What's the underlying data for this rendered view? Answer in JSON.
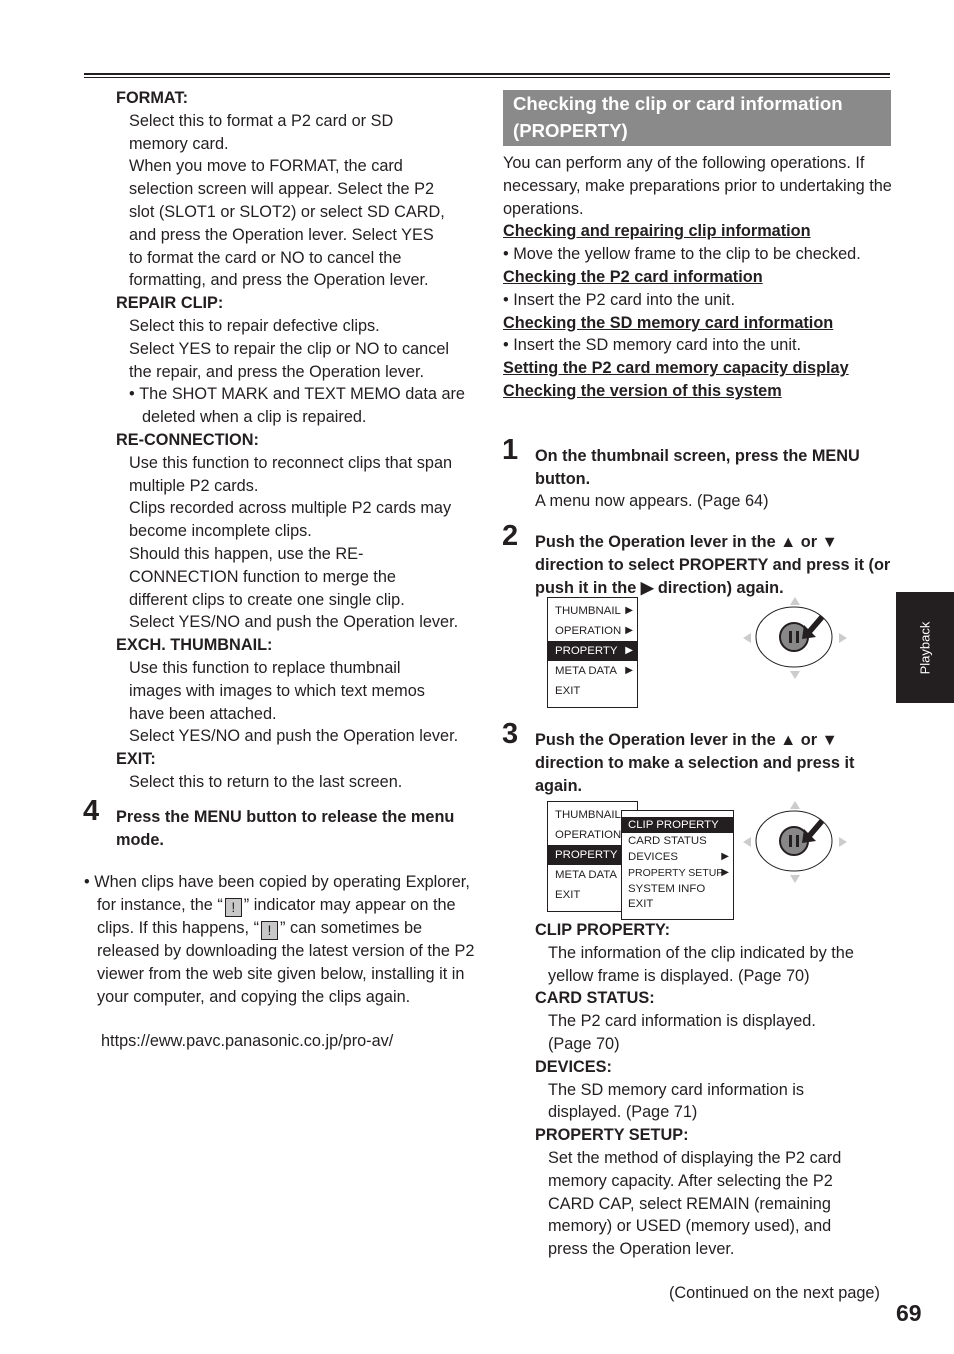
{
  "left": {
    "items": [
      {
        "term": "FORMAT:",
        "lines": [
          "Select this to format a P2 card or SD",
          "memory card.",
          "When you move to FORMAT, the card",
          "selection screen will appear. Select the P2",
          "slot (SLOT1 or SLOT2) or select SD CARD,",
          "and press the Operation lever. Select YES",
          "to format the card or NO to cancel the",
          "formatting, and press the Operation lever."
        ]
      },
      {
        "term": "REPAIR CLIP:",
        "lines": [
          "Select this to repair defective clips.",
          "Select YES to repair the clip or NO to cancel",
          "the repair, and press the Operation lever."
        ],
        "bullet": "The SHOT MARK and TEXT MEMO data are deleted when a clip is repaired."
      },
      {
        "term": "RE-CONNECTION:",
        "lines": [
          "Use this function to reconnect clips that span",
          "multiple P2 cards.",
          "Clips recorded across multiple P2 cards may",
          "become incomplete clips.",
          "Should this happen, use the RE-",
          "CONNECTION function to merge the",
          "different clips to create one single clip.",
          "Select YES/NO and push the Operation lever."
        ]
      },
      {
        "term": "EXCH. THUMBNAIL:",
        "lines": [
          "Use this function to replace thumbnail",
          "images with images to which text memos",
          "have been attached.",
          "Select YES/NO and push the Operation lever."
        ]
      },
      {
        "term": "EXIT:",
        "lines": [
          "Select this to return to the last screen."
        ]
      }
    ],
    "step4": {
      "number": "4",
      "text": "Press the MENU button to release the menu mode."
    },
    "note": {
      "part1": "When clips have been copied by operating Explorer, for instance, the “",
      "part2": "” indicator may appear on the clips. If this happens, “",
      "part3": "” can sometimes be released by downloading the latest version of the P2 viewer from the web site given below, installing it in your computer, and copying the clips again.",
      "indicator": "!"
    },
    "url": "https://eww.pavc.panasonic.co.jp/pro-av/"
  },
  "right": {
    "heading": "Checking the clip or card information (PROPERTY)",
    "intro": "You can perform any of the following operations. If necessary, make preparations prior to undertaking the operations.",
    "operations": [
      {
        "title": "Checking and repairing clip information",
        "bullet": "Move the yellow frame to the clip to be checked."
      },
      {
        "title": "Checking the P2 card information",
        "bullet": "Insert the P2 card into the unit."
      },
      {
        "title": "Checking the SD memory card information",
        "bullet": "Insert the SD memory card into the unit."
      },
      {
        "title": "Setting the P2 card memory capacity display",
        "bullet": null
      },
      {
        "title": "Checking the version of this system",
        "bullet": null
      }
    ],
    "step1": {
      "number": "1",
      "text": "On the thumbnail screen, press the MENU button.",
      "sub": "A menu now appears. (Page 64)"
    },
    "step2": {
      "number": "2",
      "text": "Push the Operation lever in the ▲ or ▼ direction to select PROPERTY and press it (or push it in the ▶ direction) again."
    },
    "step3": {
      "number": "3",
      "text": "Push the Operation lever in the ▲ or ▼ direction to make a selection and press it again."
    },
    "menu": {
      "items": [
        {
          "label": "THUMBNAIL",
          "arrow": "▶",
          "selected": false
        },
        {
          "label": "OPERATION",
          "arrow": "▶",
          "selected": false
        },
        {
          "label": "PROPERTY",
          "arrow": "▶",
          "selected": true
        },
        {
          "label": "META DATA",
          "arrow": "▶",
          "selected": false
        },
        {
          "label": "EXIT",
          "arrow": "",
          "selected": false
        }
      ]
    },
    "submenu": {
      "items": [
        {
          "label": "CLIP PROPERTY",
          "arrow": "",
          "selected": true
        },
        {
          "label": "CARD STATUS",
          "arrow": "",
          "selected": false
        },
        {
          "label": "DEVICES",
          "arrow": "▶",
          "selected": false
        },
        {
          "label": "PROPERTY SETUP",
          "arrow": "▶",
          "selected": false
        },
        {
          "label": "SYSTEM INFO",
          "arrow": "",
          "selected": false
        },
        {
          "label": "EXIT",
          "arrow": "",
          "selected": false
        }
      ]
    },
    "properties": [
      {
        "term": "CLIP PROPERTY:",
        "text": "The information of the clip indicated by the yellow frame is displayed. (Page 70)"
      },
      {
        "term": "CARD STATUS:",
        "text": "The P2 card information is displayed. (Page 70)"
      },
      {
        "term": "DEVICES:",
        "text": "The SD memory card information is displayed. (Page 71)"
      },
      {
        "term": "PROPERTY SETUP:",
        "text": "Set the method of displaying the P2 card memory capacity. After selecting the P2 CARD CAP, select REMAIN (remaining memory) or USED (memory used), and press the Operation lever."
      }
    ]
  },
  "side_tab": "Playback",
  "continued": "(Continued on the next page)",
  "page_number": "69"
}
